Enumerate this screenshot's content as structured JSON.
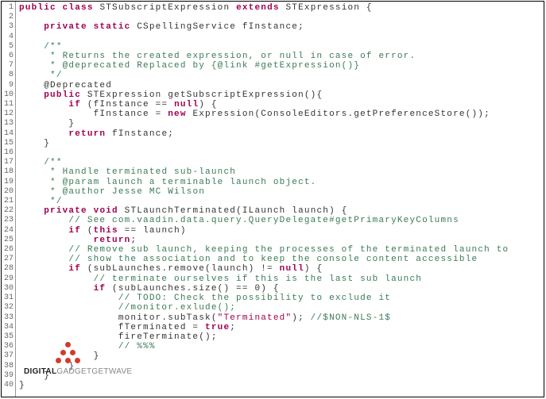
{
  "lines": [
    {
      "n": 1,
      "html": "<span class='kw'>public</span> <span class='kw'>class</span> STSubscriptExpression <span class='kw'>extends</span> STExpression {"
    },
    {
      "n": 2,
      "html": ""
    },
    {
      "n": 3,
      "html": "    <span class='kw'>private</span> <span class='kw'>static</span> CSpellingService fInstance;"
    },
    {
      "n": 4,
      "html": ""
    },
    {
      "n": 5,
      "html": "    <span class='cm'>/**</span>"
    },
    {
      "n": 6,
      "html": "    <span class='cm'> * Returns the created expression, or null in case of error.</span>"
    },
    {
      "n": 7,
      "html": "    <span class='cm'> * @deprecated Replaced by {@link #getExpression()}</span>"
    },
    {
      "n": 8,
      "html": "    <span class='cm'> */</span>"
    },
    {
      "n": 9,
      "html": "    @Deprecated"
    },
    {
      "n": 10,
      "html": "    <span class='kw'>public</span> STExpression getSubscriptExpression(){"
    },
    {
      "n": 11,
      "html": "        <span class='kw'>if</span> (fInstance == <span class='kw'>null</span>) {"
    },
    {
      "n": 12,
      "html": "            fInstance = <span class='kw'>new</span> Expression(ConsoleEditors.getPreferenceStore());"
    },
    {
      "n": 13,
      "html": "        }"
    },
    {
      "n": 14,
      "html": "        <span class='kw'>return</span> fInstance;"
    },
    {
      "n": 15,
      "html": "    }"
    },
    {
      "n": 16,
      "html": ""
    },
    {
      "n": 17,
      "html": "    <span class='cm'>/**</span>"
    },
    {
      "n": 18,
      "html": "    <span class='cm'> * Handle terminated sub-launch</span>"
    },
    {
      "n": 19,
      "html": "    <span class='cm'> * @param launch a terminable launch object.</span>"
    },
    {
      "n": 20,
      "html": "    <span class='cm'> * @author Jesse MC Wilson</span>"
    },
    {
      "n": 21,
      "html": "    <span class='cm'> */</span>"
    },
    {
      "n": 22,
      "html": "    <span class='kw'>private</span> <span class='kw'>void</span> STLaunchTerminated(ILaunch launch) {"
    },
    {
      "n": 23,
      "html": "        <span class='cm'>// See com.vaadin.data.query.QueryDelegate#getPrimaryKeyColumns</span>"
    },
    {
      "n": 24,
      "html": "        <span class='kw'>if</span> (<span class='kw'>this</span> == launch)"
    },
    {
      "n": 25,
      "html": "            <span class='kw'>return</span>;"
    },
    {
      "n": 26,
      "html": "        <span class='cm'>// Remove sub launch, keeping the processes of the terminated launch to</span>"
    },
    {
      "n": 27,
      "html": "        <span class='cm'>// show the association and to keep the console content accessible</span>"
    },
    {
      "n": 28,
      "html": "        <span class='kw'>if</span> (subLaunches.remove(launch) != <span class='kw'>null</span>) {"
    },
    {
      "n": 29,
      "html": "            <span class='cm'>// terminate ourselves if this is the last sub launch</span>"
    },
    {
      "n": 30,
      "html": "            <span class='kw'>if</span> (subLaunches.size() == 0) {"
    },
    {
      "n": 31,
      "html": "                <span class='cm'>// TODO: Check the possibility to exclude it</span>"
    },
    {
      "n": 32,
      "html": "                <span class='cm'>//monitor.exlude();</span>"
    },
    {
      "n": 33,
      "html": "                monitor.subTask(<span class='str'>\"Terminated\"</span>); <span class='cm'>//$NON-NLS-1$</span>"
    },
    {
      "n": 34,
      "html": "                fTerminated = <span class='kw'>true</span>;"
    },
    {
      "n": 35,
      "html": "                fireTerminate();"
    },
    {
      "n": 36,
      "html": "                <span class='cm'>// %%%</span>"
    },
    {
      "n": 37,
      "html": "            }"
    },
    {
      "n": 38,
      "html": "        }"
    },
    {
      "n": 39,
      "html": "    }"
    },
    {
      "n": 40,
      "html": "}"
    }
  ],
  "watermark": {
    "bold": "DIGITAL",
    "rest": "GADGETGETWAVE"
  }
}
